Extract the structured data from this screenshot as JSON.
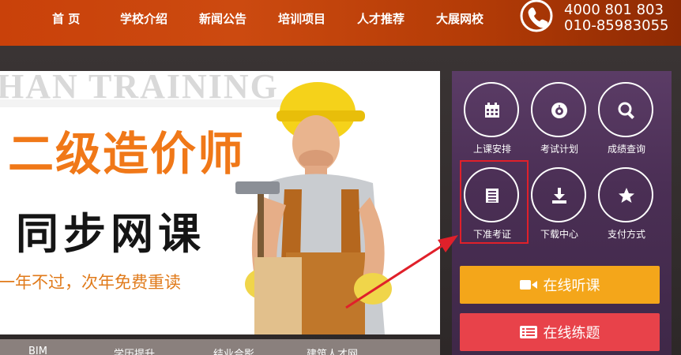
{
  "nav": {
    "items": [
      {
        "label": "首 页"
      },
      {
        "label": "学校介绍"
      },
      {
        "label": "新闻公告"
      },
      {
        "label": "培训项目"
      },
      {
        "label": "人才推荐"
      },
      {
        "label": "大展网校"
      }
    ]
  },
  "contact": {
    "phone1": "4000 801 803",
    "phone2": "010-85983055",
    "icon": "phone-icon"
  },
  "banner": {
    "watermark": "HAN TRAINING",
    "title": "二级造价师",
    "subtitle": "同步网课",
    "tagline": "一年不过，次年免费重读"
  },
  "bottom_strip": {
    "items": [
      "BIM",
      "学历提升",
      "结业合影",
      "建筑人才网"
    ]
  },
  "services": {
    "items": [
      {
        "label": "上课安排",
        "icon": "calendar-icon"
      },
      {
        "label": "考试计划",
        "icon": "gauge-icon"
      },
      {
        "label": "成绩查询",
        "icon": "search-icon"
      },
      {
        "label": "下准考证",
        "icon": "list-icon"
      },
      {
        "label": "下载中心",
        "icon": "download-icon"
      },
      {
        "label": "支付方式",
        "icon": "star-icon"
      }
    ]
  },
  "actions": {
    "listen": {
      "label": "在线听课",
      "icon": "video-camera-icon",
      "color": "#f4a61a"
    },
    "practice": {
      "label": "在线练题",
      "icon": "list-icon",
      "color": "#e8424a"
    }
  },
  "colors": {
    "header": "#c9410a",
    "panel": "#4b2f55",
    "highlight": "#e0202a",
    "title": "#f07818"
  }
}
